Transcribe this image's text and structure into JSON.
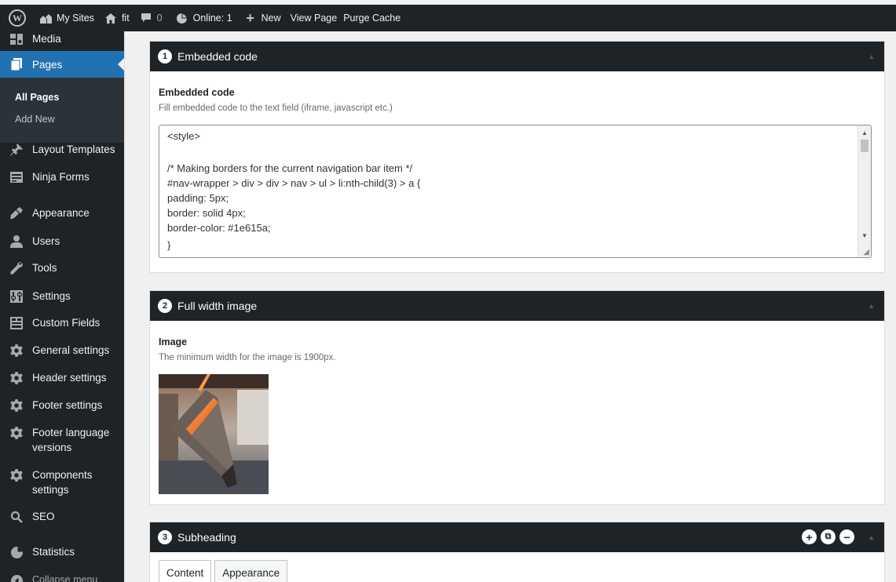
{
  "adminbar": {
    "my_sites": "My Sites",
    "site_name": "fit",
    "comments_count": "0",
    "online": "Online: 1",
    "new": "New",
    "view_page": "View Page",
    "purge_cache": "Purge Cache"
  },
  "sidebar": {
    "items": [
      {
        "label": "Media",
        "icon": "media-icon"
      },
      {
        "label": "Pages",
        "icon": "pages-icon"
      },
      {
        "label": "Layout Templates",
        "icon": "pin-icon"
      },
      {
        "label": "Ninja Forms",
        "icon": "forms-icon"
      },
      {
        "label": "Appearance",
        "icon": "brush-icon"
      },
      {
        "label": "Users",
        "icon": "users-icon"
      },
      {
        "label": "Tools",
        "icon": "wrench-icon"
      },
      {
        "label": "Settings",
        "icon": "settings-icon"
      },
      {
        "label": "Custom Fields",
        "icon": "fields-icon"
      },
      {
        "label": "General settings",
        "icon": "gear-icon"
      },
      {
        "label": "Header settings",
        "icon": "gear-icon"
      },
      {
        "label": "Footer settings",
        "icon": "gear-icon"
      },
      {
        "label": "Footer language versions",
        "icon": "gear-icon"
      },
      {
        "label": "Components settings",
        "icon": "gear-icon"
      },
      {
        "label": "SEO",
        "icon": "search-icon"
      },
      {
        "label": "Statistics",
        "icon": "pie-icon"
      },
      {
        "label": "Collapse menu",
        "icon": "collapse-icon"
      }
    ],
    "submenu": {
      "all_pages": "All Pages",
      "add_new": "Add New"
    }
  },
  "panels": {
    "embedded": {
      "number": "1",
      "title": "Embedded code",
      "field_label": "Embedded code",
      "field_desc": "Fill embedded code to the text field (iframe, javascript etc.)",
      "code_lines": [
        "<style>",
        "",
        "/* Making borders for the current navigation bar item */",
        "#nav-wrapper > div > div > nav > ul > li:nth-child(3) > a {",
        "padding: 5px;",
        "border: solid 4px;",
        "border-color: #1e615a;",
        "}"
      ]
    },
    "image": {
      "number": "2",
      "title": "Full width image",
      "field_label": "Image",
      "field_desc": "The minimum width for the image is 1900px."
    },
    "subheading": {
      "number": "3",
      "title": "Subheading",
      "tabs": [
        "Content",
        "Appearance"
      ]
    }
  },
  "colors": {
    "admin_dark": "#1d2327",
    "accent": "#2271b1",
    "main_bg": "#f0f0f1"
  }
}
